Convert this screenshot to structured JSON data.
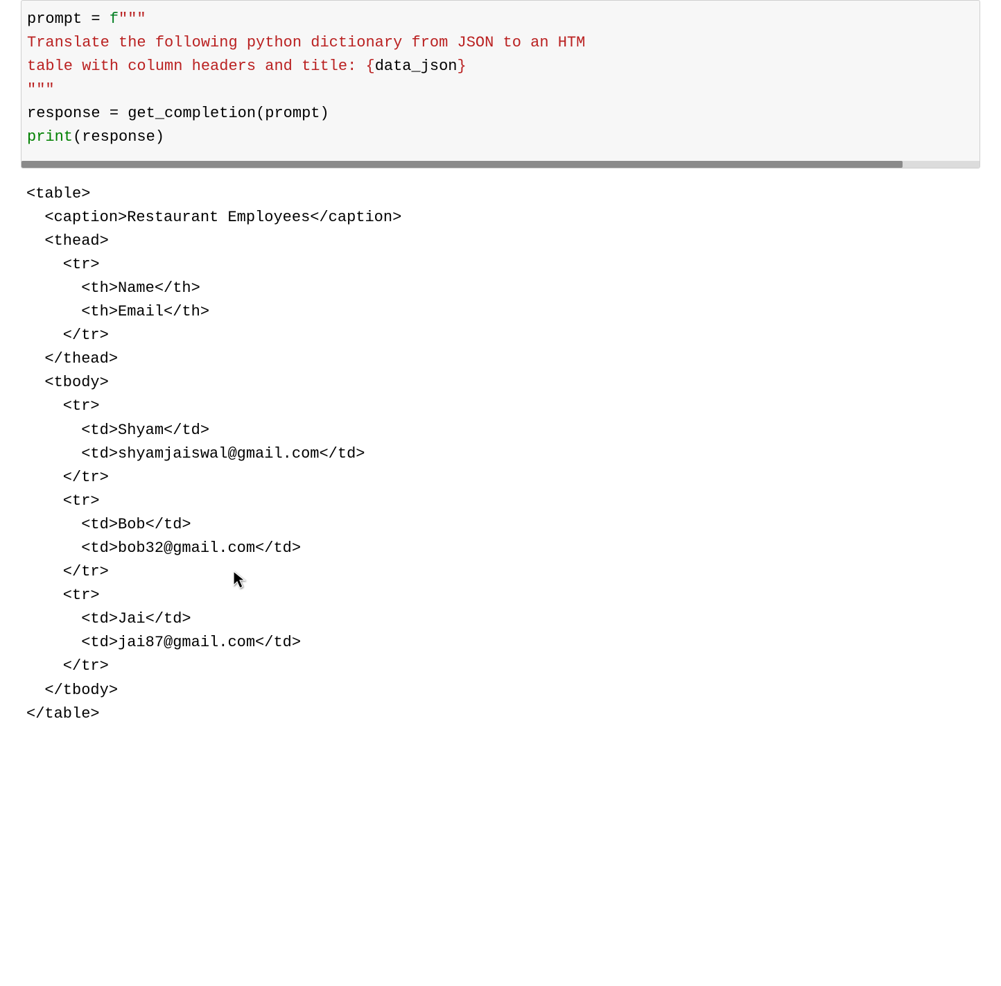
{
  "code_cell": {
    "line1_var": "prompt",
    "line1_op": " = ",
    "line1_prefix": "f",
    "line1_str_open": "\"\"\"",
    "line2_str": "Translate the following python dictionary from JSON to an HTML \\",
    "line2_str_visible": "Translate the following python dictionary from JSON to an HTM",
    "line3_str_a": "table with column headers and title: ",
    "line3_interp_open": "{",
    "line3_interp_var": "data_json",
    "line3_interp_close": "}",
    "line4_str_close": "\"\"\"",
    "line5_var": "response",
    "line5_op": " = ",
    "line5_func": "get_completion",
    "line5_arg": "(prompt)",
    "line6_builtin": "print",
    "line6_arg": "(response)"
  },
  "output": {
    "l1": "<table>",
    "l2": "  <caption>Restaurant Employees</caption>",
    "l3": "  <thead>",
    "l4": "    <tr>",
    "l5": "      <th>Name</th>",
    "l6": "      <th>Email</th>",
    "l7": "    </tr>",
    "l8": "  </thead>",
    "l9": "  <tbody>",
    "l10": "    <tr>",
    "l11": "      <td>Shyam</td>",
    "l12": "      <td>shyamjaiswal@gmail.com</td>",
    "l13": "    </tr>",
    "l14": "    <tr>",
    "l15": "      <td>Bob</td>",
    "l16": "      <td>bob32@gmail.com</td>",
    "l17": "    </tr>",
    "l18": "    <tr>",
    "l19": "      <td>Jai</td>",
    "l20": "      <td>jai87@gmail.com</td>",
    "l21": "    </tr>",
    "l22": "  </tbody>",
    "l23": "</table>"
  }
}
